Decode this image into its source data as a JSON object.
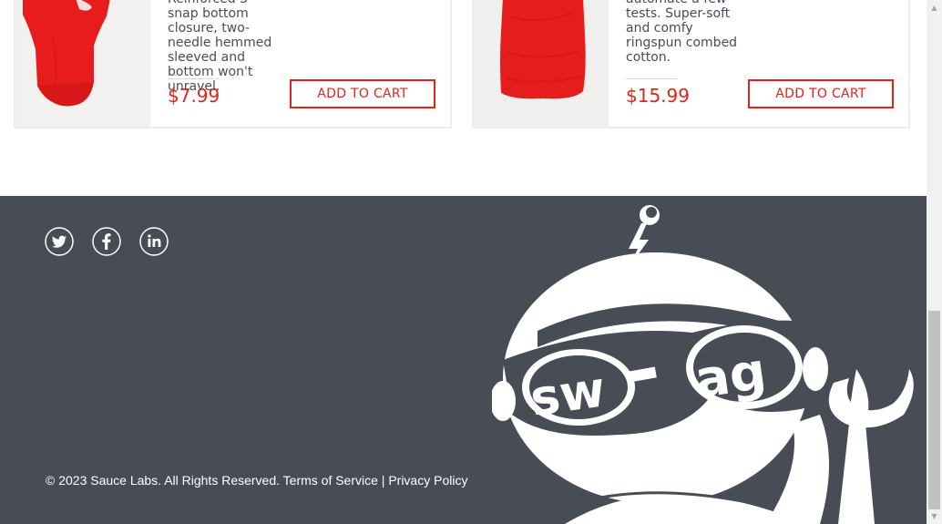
{
  "products": [
    {
      "description": "Reinforced 3-snap bottom closure, two-needle hemmed sleeved and bottom won't unravel.",
      "price": "$7.99",
      "button_label": "ADD TO CART",
      "image_icon": "red-onesie-image"
    },
    {
      "description": "automate a few tests. Super-soft and comfy ringspun combed cotton.",
      "price": "$15.99",
      "button_label": "ADD TO CART",
      "image_icon": "red-tshirt-image"
    }
  ],
  "footer": {
    "social": [
      "twitter-icon",
      "facebook-icon",
      "linkedin-icon"
    ],
    "copyright": "© 2023 Sauce Labs. All Rights Reserved. Terms of Service | Privacy Policy",
    "robot_text": "swag"
  },
  "colors": {
    "accent": "#e2231a",
    "footer_bg": "#474c55",
    "text": "#484c55"
  }
}
